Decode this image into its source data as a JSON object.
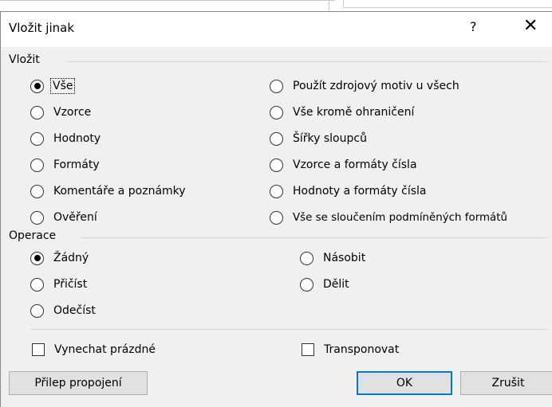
{
  "dialog": {
    "title": "Vložit jinak",
    "help_label": "?",
    "close_label": "✕"
  },
  "paste": {
    "group_label": "Vložit",
    "left_options": [
      {
        "label": "Vše",
        "selected": true
      },
      {
        "label": "Vzorce",
        "selected": false
      },
      {
        "label": "Hodnoty",
        "selected": false
      },
      {
        "label": "Formáty",
        "selected": false
      },
      {
        "label": "Komentáře a poznámky",
        "selected": false
      },
      {
        "label": "Ověření",
        "selected": false
      }
    ],
    "right_options": [
      {
        "label": "Použít zdrojový motiv u všech",
        "selected": false
      },
      {
        "label": "Vše kromě ohraničení",
        "selected": false
      },
      {
        "label": "Šířky sloupců",
        "selected": false
      },
      {
        "label": "Vzorce a formáty čísla",
        "selected": false
      },
      {
        "label": "Hodnoty a formáty čísla",
        "selected": false
      },
      {
        "label": "Vše se sloučením podmíněných formátů",
        "selected": false
      }
    ]
  },
  "operation": {
    "group_label": "Operace",
    "left_options": [
      {
        "label": "Žádný",
        "selected": true
      },
      {
        "label": "Přičíst",
        "selected": false
      },
      {
        "label": "Odečíst",
        "selected": false
      }
    ],
    "right_options": [
      {
        "label": "Násobit",
        "selected": false
      },
      {
        "label": "Dělit",
        "selected": false
      }
    ]
  },
  "checkboxes": {
    "skip_blanks": {
      "label": "Vynechat prázdné",
      "checked": false
    },
    "transpose": {
      "label": "Transponovat",
      "checked": false
    }
  },
  "buttons": {
    "paste_link": "Přilep propojení",
    "ok": "OK",
    "cancel": "Zrušit"
  }
}
